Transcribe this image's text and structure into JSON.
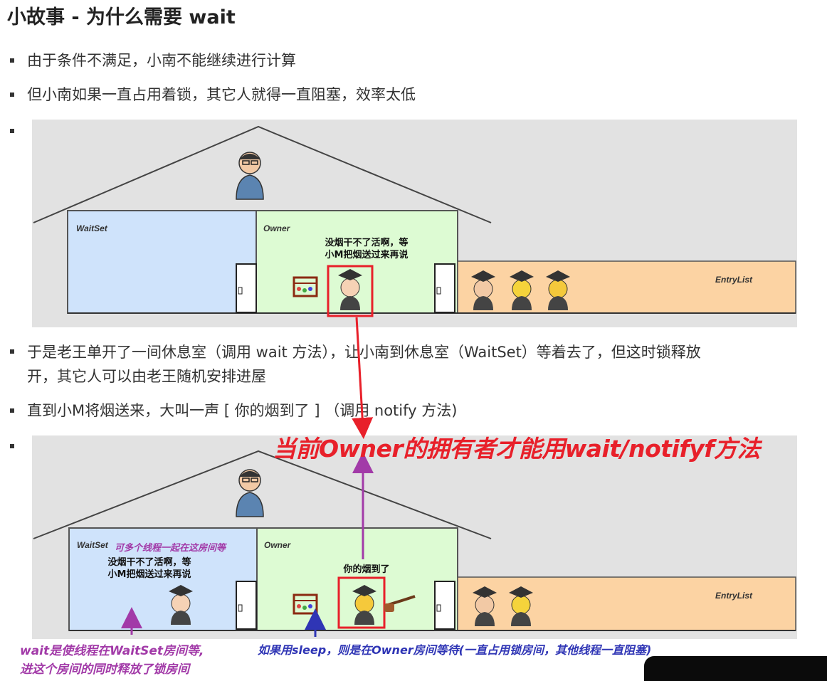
{
  "title": "小故事 - 为什么需要 wait",
  "bullets": {
    "b1": "由于条件不满足，小南不能继续进行计算",
    "b2": "但小南如果一直占用着锁，其它人就得一直阻塞，效率太低",
    "b3a": "于是老王单开了一间休息室（调用 wait 方法），让小南到休息室（WaitSet）等着去了，但这时锁释放",
    "b3b": "开，其它人可以由老王随机安排进屋",
    "b4": "直到小M将烟送来，大叫一声 [ 你的烟到了 ] （调用 notify 方法)"
  },
  "scene1": {
    "waitset": "WaitSet",
    "owner": "Owner",
    "entrylist": "EntryList",
    "speech_line1": "没烟干不了活啊，等",
    "speech_line2": "小M把烟送过来再说"
  },
  "scene2": {
    "waitset": "WaitSet",
    "owner": "Owner",
    "entrylist": "EntryList",
    "speech_line1": "没烟干不了活啊，等",
    "speech_line2": "小M把烟送过来再说",
    "delivery": "你的烟到了"
  },
  "annotations": {
    "owner_rule": "当前Owner的拥有者才能用wait/notifyf方法",
    "waitset_note": "可多个线程一起在这房间等",
    "wait_line1": "wait是使线程在WaitSet房间等,",
    "wait_line2": "进这个房间的同时释放了锁房间",
    "sleep_note": "如果用sleep，则是在Owner房间等待(一直占用锁房间，其他线程一直阻塞)"
  },
  "colors": {
    "waitset_room": "#cfe3fb",
    "owner_room": "#ddfbd3",
    "entry_room": "#fcd3a3",
    "red": "#e8202a",
    "purple": "#a23aa8",
    "blue": "#2f35b5"
  }
}
